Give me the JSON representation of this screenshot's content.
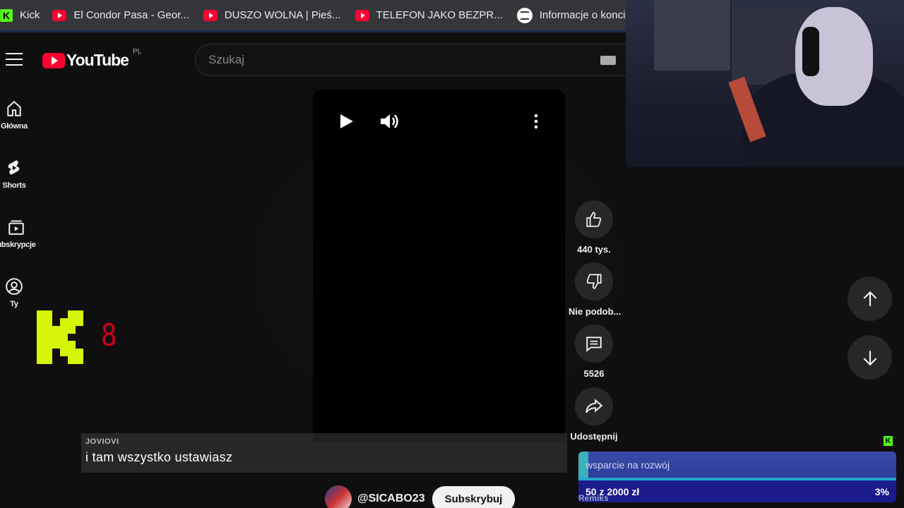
{
  "bookmarks": [
    {
      "label": "Kick",
      "icon": "kick"
    },
    {
      "label": "El Condor Pasa - Geor...",
      "icon": "youtube"
    },
    {
      "label": "DUSZO WOLNA | Pieś...",
      "icon": "youtube"
    },
    {
      "label": "TELEFON JAKO BEZPR...",
      "icon": "youtube"
    },
    {
      "label": "Informacje o koncie -",
      "icon": "spotify"
    }
  ],
  "youtube": {
    "logo_text": "YouTube",
    "country": "PL",
    "search_placeholder": "Szukaj"
  },
  "sidebar": {
    "items": [
      {
        "label": "Główna",
        "icon": "home-icon"
      },
      {
        "label": "Shorts",
        "icon": "shorts-icon"
      },
      {
        "label": "ubskrypcje",
        "icon": "subscriptions-icon"
      },
      {
        "label": "Ty",
        "icon": "user-icon"
      }
    ]
  },
  "kick_overlay": {
    "count": "8"
  },
  "actions": {
    "like_count": "440 tys.",
    "dislike_label": "Nie podob...",
    "comments_count": "5526",
    "share_label": "Udostępnij"
  },
  "channel": {
    "handle": "@SICABO23",
    "subscribe_label": "Subskrybuj"
  },
  "chat": {
    "username": "JOVIOVI",
    "message": "i tam wszystko ustawiasz"
  },
  "goal": {
    "title": "wsparcie na rozwój",
    "progress_text": "50 z 2000 zł",
    "percent_text": "3%",
    "progress": 0.03,
    "footer": "Remiks"
  },
  "colors": {
    "kick_green": "#53fc18",
    "youtube_red": "#ff0033",
    "goal_blue": "#1b1b8c"
  }
}
